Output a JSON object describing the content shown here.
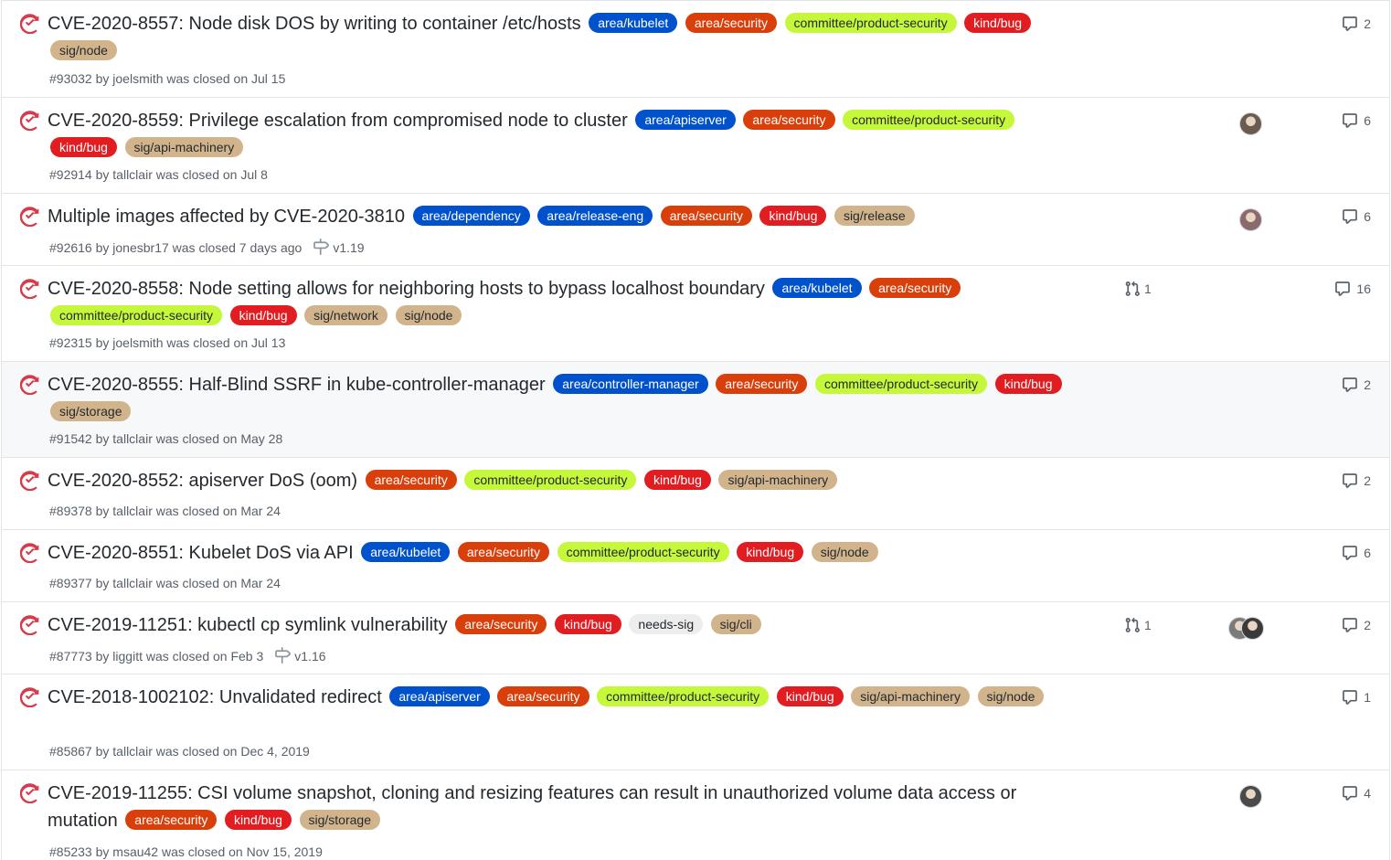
{
  "issues": [
    {
      "title": "CVE-2020-8557: Node disk DOS by writing to container /etc/hosts",
      "labels": [
        "area/kubelet",
        "area/security",
        "committee/product-security",
        "kind/bug",
        "sig/node"
      ],
      "number": "#93032",
      "meta_rest": " by joelsmith was closed on Jul 15",
      "comments": "2"
    },
    {
      "title": "CVE-2020-8559: Privilege escalation from compromised node to cluster",
      "labels": [
        "area/apiserver",
        "area/security",
        "committee/product-security",
        "kind/bug",
        "sig/api-machinery"
      ],
      "number": "#92914",
      "meta_rest": " by tallclair was closed on Jul 8",
      "comments": "6"
    },
    {
      "title": "Multiple images affected by CVE-2020-3810",
      "labels": [
        "area/dependency",
        "area/release-eng",
        "area/security",
        "kind/bug",
        "sig/release"
      ],
      "number": "#92616",
      "meta_rest": " by jonesbr17 was closed 7 days ago",
      "milestone": "v1.19",
      "comments": "6"
    },
    {
      "title": "CVE-2020-8558: Node setting allows for neighboring hosts to bypass localhost boundary",
      "labels": [
        "area/kubelet",
        "area/security",
        "committee/product-security",
        "kind/bug",
        "sig/network",
        "sig/node"
      ],
      "number": "#92315",
      "meta_rest": " by joelsmith was closed on Jul 13",
      "linked_prs": "1",
      "comments": "16"
    },
    {
      "title": "CVE-2020-8555: Half-Blind SSRF in kube-controller-manager",
      "labels": [
        "area/controller-manager",
        "area/security",
        "committee/product-security",
        "kind/bug",
        "sig/storage"
      ],
      "number": "#91542",
      "meta_rest": " by tallclair was closed on May 28",
      "comments": "2"
    },
    {
      "title": "CVE-2020-8552: apiserver DoS (oom)",
      "labels": [
        "area/security",
        "committee/product-security",
        "kind/bug",
        "sig/api-machinery"
      ],
      "number": "#89378",
      "meta_rest": " by tallclair was closed on Mar 24",
      "comments": "2"
    },
    {
      "title": "CVE-2020-8551: Kubelet DoS via API",
      "labels": [
        "area/kubelet",
        "area/security",
        "committee/product-security",
        "kind/bug",
        "sig/node"
      ],
      "number": "#89377",
      "meta_rest": " by tallclair was closed on Mar 24",
      "comments": "6"
    },
    {
      "title": "CVE-2019-11251: kubectl cp symlink vulnerability",
      "labels": [
        "area/security",
        "kind/bug",
        "needs-sig",
        "sig/cli"
      ],
      "number": "#87773",
      "meta_rest": " by liggitt was closed on Feb 3",
      "milestone": "v1.16",
      "linked_prs": "1",
      "comments": "2"
    },
    {
      "title": "CVE-2018-1002102: Unvalidated redirect",
      "labels": [
        "area/apiserver",
        "area/security",
        "committee/product-security",
        "kind/bug",
        "sig/api-machinery",
        "sig/node"
      ],
      "number": "#85867",
      "meta_rest": " by tallclair was closed on Dec 4, 2019",
      "comments": "1"
    },
    {
      "title": "CVE-2019-11255: CSI volume snapshot, cloning and resizing features can result in unauthorized volume data access or mutation",
      "labels": [
        "area/security",
        "kind/bug",
        "sig/storage"
      ],
      "number": "#85233",
      "meta_rest": " by msau42 was closed on Nov 15, 2019",
      "comments": "4"
    }
  ],
  "colors": {
    "closed_icon": "#d73a49",
    "area": "#0052cc",
    "security": "#d93f0b",
    "committee": "#c5f73b",
    "kind_bug": "#e11d21",
    "sig": "#d2b48c",
    "needs_sig": "#ededed"
  }
}
